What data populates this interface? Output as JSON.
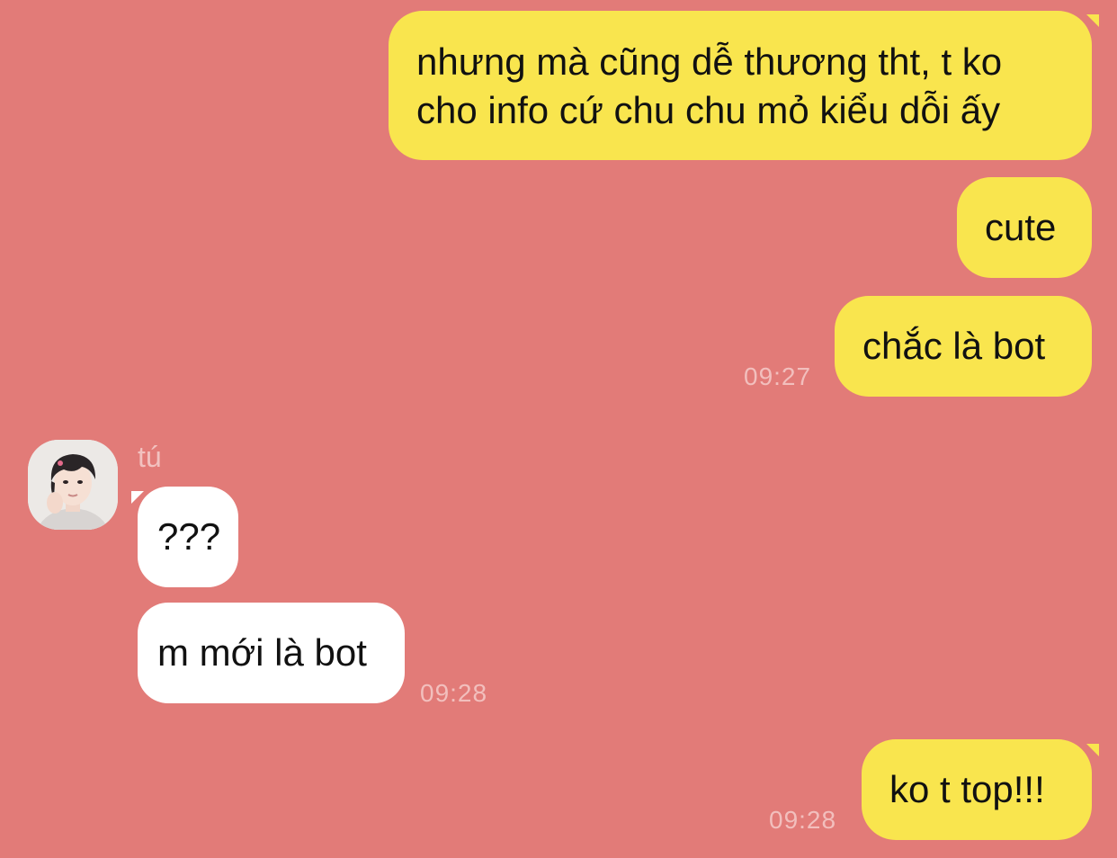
{
  "colors": {
    "background": "#e27b78",
    "outgoing_bubble": "#f9e54e",
    "incoming_bubble": "#ffffff",
    "timestamp": "#f2bfbd"
  },
  "messages": [
    {
      "direction": "outgoing",
      "lines": [
        "nhưng mà cũng dễ thương tht, t ko",
        "cho info cứ chu chu mỏ kiểu dỗi ấy"
      ]
    },
    {
      "direction": "outgoing",
      "text": "cute"
    },
    {
      "direction": "outgoing",
      "text": "chắc là bot",
      "time": "09:27"
    },
    {
      "direction": "incoming",
      "sender": "tú",
      "avatar_icon": "user-avatar",
      "text": "???"
    },
    {
      "direction": "incoming",
      "text": "m mới là bot",
      "time": "09:28"
    },
    {
      "direction": "outgoing",
      "text": "ko t top!!!",
      "time": "09:28"
    }
  ]
}
